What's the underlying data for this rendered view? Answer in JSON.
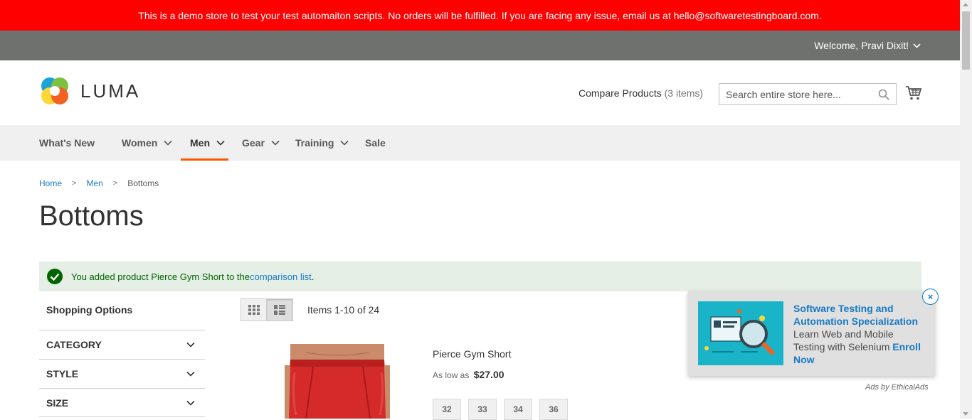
{
  "banner": {
    "text": "This is a demo store to test your test automaiton scripts. No orders will be fulfilled. If you are facing any issue, email us at hello@softwaretestingboard.com."
  },
  "header_panel": {
    "welcome": "Welcome, Pravi Dixit!"
  },
  "header": {
    "logo_text": "LUMA",
    "compare_label": "Compare Products",
    "compare_count": "(3 items)",
    "search_placeholder": "Search entire store here..."
  },
  "nav": {
    "items": [
      {
        "label": "What's New"
      },
      {
        "label": "Women"
      },
      {
        "label": "Men"
      },
      {
        "label": "Gear"
      },
      {
        "label": "Training"
      },
      {
        "label": "Sale"
      }
    ],
    "active": "Men"
  },
  "breadcrumbs": {
    "home": "Home",
    "men": "Men",
    "current": "Bottoms",
    "separator": ">"
  },
  "page_title": "Bottoms",
  "message": {
    "text_before": "You added product Pierce Gym Short to the ",
    "link": "comparison list",
    "text_after": "."
  },
  "sidebar": {
    "title": "Shopping Options",
    "filters": [
      {
        "label": "CATEGORY"
      },
      {
        "label": "STYLE"
      },
      {
        "label": "SIZE"
      }
    ]
  },
  "toolbar": {
    "items_count": "Items 1-10 of 24",
    "active_mode": "list"
  },
  "product": {
    "name": "Pierce Gym Short",
    "price_prefix": "As low as",
    "price": "$27.00",
    "sizes": [
      "32",
      "33",
      "34",
      "36"
    ]
  },
  "ad": {
    "title": "Software Testing and Automation Specialization",
    "body": "Learn Web and Mobile Testing with Selenium ",
    "cta": "Enroll Now",
    "credit": "Ads by EthicalAds",
    "close": "×"
  },
  "colors": {
    "banner_red": "#ff0000",
    "panel_gray": "#6e716e",
    "nav_active": "#ff5501",
    "link_blue": "#1979c3",
    "success_bg": "#e5efe5",
    "success_text": "#006400"
  }
}
